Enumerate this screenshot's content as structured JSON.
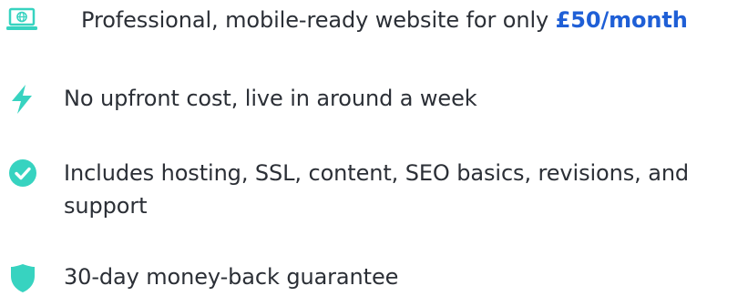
{
  "features": [
    {
      "icon": "laptop-globe-icon",
      "text": "Professional, mobile-ready website for only ",
      "highlight": "£50/month"
    },
    {
      "icon": "lightning-bolt-icon",
      "text": "No upfront cost, live in around a week"
    },
    {
      "icon": "check-circle-icon",
      "text": "Includes hosting, SSL, content, SEO basics, revisions, and support"
    },
    {
      "icon": "shield-icon",
      "text": "30-day money-back guarantee"
    }
  ],
  "colors": {
    "accent": "#37d3c0",
    "highlight": "#1f5fd6",
    "text": "#2b2f36"
  }
}
